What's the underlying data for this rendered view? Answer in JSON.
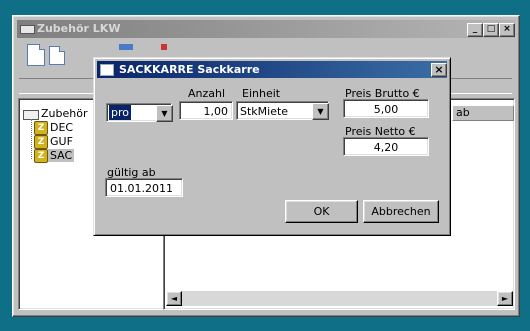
{
  "window": {
    "title": "Zubehör LKW",
    "minimize": "_",
    "maximize": "□",
    "close": "×"
  },
  "tree": {
    "root": "Zubehör",
    "items": [
      "DEC",
      "GUF",
      "SAC"
    ],
    "item_badge": "Z"
  },
  "grid": {
    "column_ab": "ab"
  },
  "dialog": {
    "title": "SACKKARRE Sackkarre",
    "close": "×",
    "pro_select": "pro",
    "anzahl_label": "Anzahl",
    "anzahl_value": "1,00",
    "einheit_label": "Einheit",
    "einheit_value": "StkMiete",
    "preis_brutto_label": "Preis Brutto €",
    "preis_brutto_value": "5,00",
    "preis_netto_label": "Preis Netto €",
    "preis_netto_value": "4,20",
    "gueltig_label": "gültig ab",
    "gueltig_value": "01.01.2011",
    "ok_label": "OK",
    "cancel_label": "Abbrechen"
  },
  "scrollbar": {
    "left_arrow": "◄",
    "right_arrow": "►"
  }
}
